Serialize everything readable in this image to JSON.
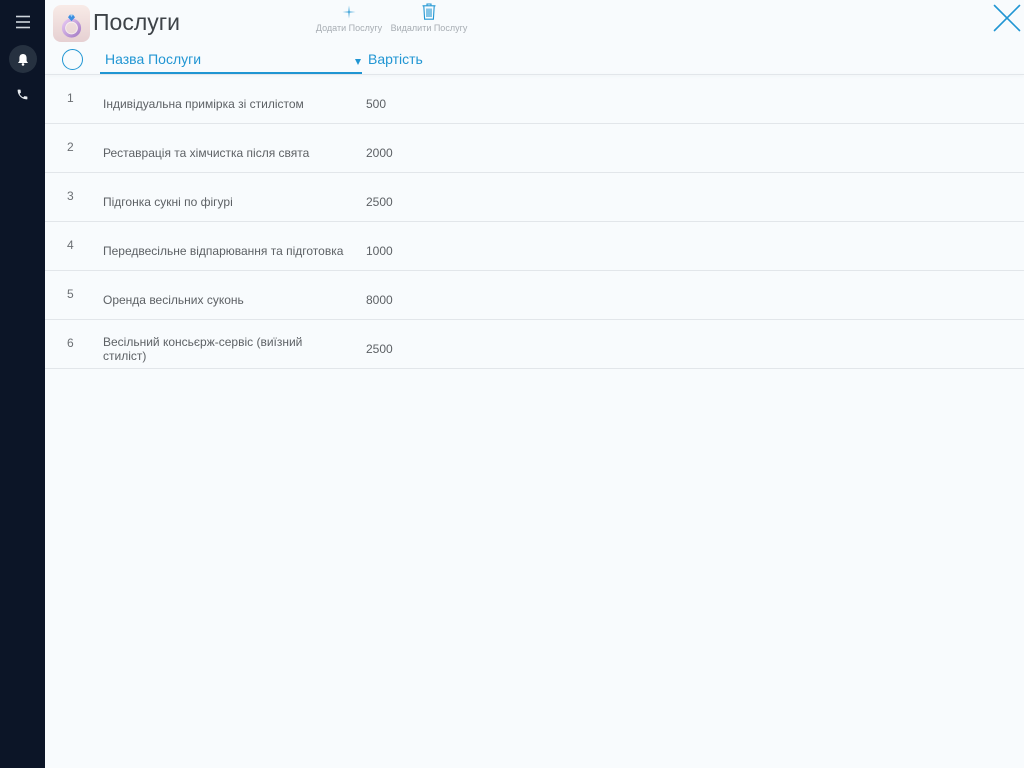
{
  "app": {
    "title": "Послуги",
    "icon": "ring-icon"
  },
  "sidebar": {
    "items": [
      {
        "icon": "menu-icon"
      },
      {
        "icon": "bell-icon",
        "active": true
      },
      {
        "icon": "phone-icon"
      }
    ]
  },
  "toolbar": {
    "add": {
      "label": "Додати Послугу",
      "icon": "plus-icon"
    },
    "delete": {
      "label": "Видалити Послугу",
      "icon": "trash-icon"
    },
    "close": {
      "icon": "close-icon"
    }
  },
  "table": {
    "select_all": {
      "checked": false
    },
    "columns": [
      {
        "label": "Назва Послуги",
        "sort_icon": "sort-down-icon"
      },
      {
        "label": "Вартість"
      }
    ],
    "rows": [
      {
        "num": "1",
        "name": "Індивідуальна примірка зі стилістом",
        "price": "500"
      },
      {
        "num": "2",
        "name": "Реставрація та хімчистка після свята",
        "price": "2000"
      },
      {
        "num": "3",
        "name": "Підгонка сукні по фігурі",
        "price": "2500"
      },
      {
        "num": "4",
        "name": "Передвесільне відпарювання та підготовка",
        "price": "1000"
      },
      {
        "num": "5",
        "name": "Оренда весільних суконь",
        "price": "8000"
      },
      {
        "num": "6",
        "name": "Весільний консьєрж-сервіс (виїзний стиліст)",
        "price": "2500"
      }
    ]
  },
  "colors": {
    "accent": "#2196d3",
    "sidebar": "#0c1527",
    "sidebar_active": "#263140",
    "background": "#f8fbfd",
    "text": "#5d6165",
    "muted": "#a7adb3",
    "divider": "#e2e6ea"
  }
}
